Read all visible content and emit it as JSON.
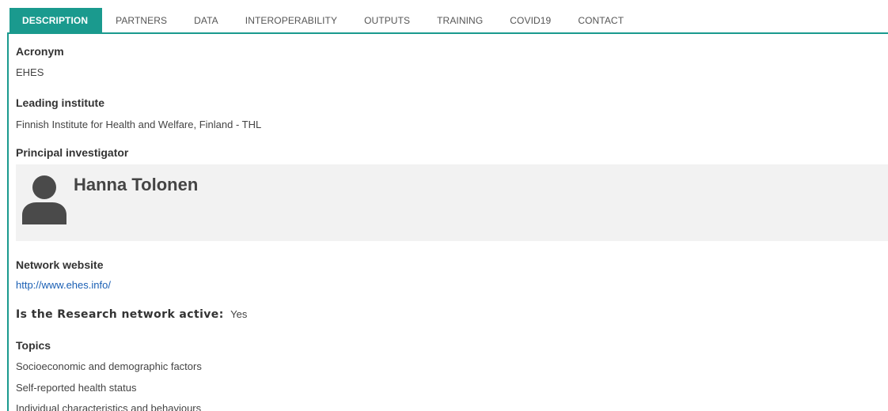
{
  "tabs": [
    {
      "label": "DESCRIPTION",
      "active": true
    },
    {
      "label": "PARTNERS",
      "active": false
    },
    {
      "label": "DATA",
      "active": false
    },
    {
      "label": "INTEROPERABILITY",
      "active": false
    },
    {
      "label": "OUTPUTS",
      "active": false
    },
    {
      "label": "TRAINING",
      "active": false
    },
    {
      "label": "COVID19",
      "active": false
    },
    {
      "label": "CONTACT",
      "active": false
    }
  ],
  "accent_color": "#1a9a8e",
  "acronym": {
    "label": "Acronym",
    "value": "EHES"
  },
  "leading_institute": {
    "label": "Leading institute",
    "value": "Finnish Institute for Health and Welfare, Finland - THL"
  },
  "principal_investigator": {
    "label": "Principal investigator",
    "name": "Hanna Tolonen",
    "icon": "person-icon"
  },
  "network_website": {
    "label": "Network website",
    "value": "http://www.ehes.info/"
  },
  "active_status": {
    "label": "Is the Research network active:",
    "value": "Yes"
  },
  "topics": {
    "label": "Topics",
    "items": [
      "Socioeconomic and demographic factors",
      "Self-reported health status",
      "Individual characteristics and behaviours"
    ]
  }
}
